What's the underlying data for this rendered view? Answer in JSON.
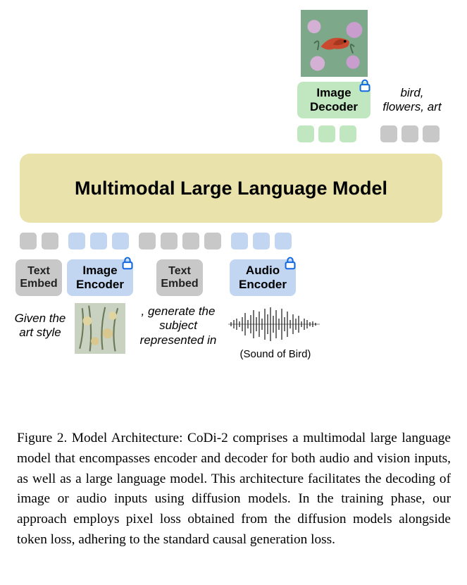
{
  "top": {
    "decoder_label": "Image\nDecoder",
    "output_text": "bird,\nflowers, art"
  },
  "llm": {
    "title": "Multimodal Large Language Model"
  },
  "encoders": {
    "text_embed_1": "Text\nEmbed",
    "image_encoder": "Image\nEncoder",
    "text_embed_2": "Text\nEmbed",
    "audio_encoder": "Audio\nEncoder"
  },
  "prompt": {
    "part1": "Given the\nart style",
    "part2": ", generate the\nsubject\nrepresented in",
    "audio_caption": "(Sound of Bird)"
  },
  "caption": {
    "text": "Figure 2. Model Architecture: CoDi-2 comprises a multimodal large language model that encompasses encoder and decoder for both audio and vision inputs, as well as a large language model. This architecture facilitates the decoding of image or audio inputs using diffusion models. In the training phase, our approach employs pixel loss obtained from the diffusion models alongside token loss, adhering to the standard causal generation loss."
  }
}
